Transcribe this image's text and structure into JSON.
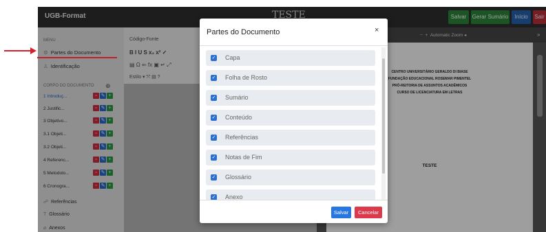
{
  "topbar": {
    "brand": "UGB-Format",
    "doc_title": "TESTE",
    "buttons": [
      "Salvar",
      "Gerar Sumário",
      "Início",
      "Sair"
    ]
  },
  "sidebar": {
    "menu_label": "MENU",
    "items": [
      {
        "icon": "settings-icon",
        "label": "Partes do Documento"
      },
      {
        "icon": "person-icon",
        "label": "Identificação"
      }
    ],
    "corpo_label": "CORPO DO DOCUMENTO",
    "sections": [
      "1 Introduç...",
      "2 Justific...",
      "3 Objetivo...",
      "3.1 Objeti...",
      "3.2 Objeti...",
      "4 Referenc...",
      "5 Metodolo...",
      "6 Cronogra..."
    ],
    "extra_items": [
      {
        "icon": "refs-icon",
        "label": "Referências"
      },
      {
        "icon": "glossary-icon",
        "label": "Glossário"
      },
      {
        "icon": "attachment-icon",
        "label": "Anexos"
      }
    ]
  },
  "editor": {
    "row1": "Código-Fonte",
    "row2": "B  I  U  S  x₂  x²  ✓",
    "row3": "▤  Ω  ⇐  fx  ▣  ↵  ⤢",
    "row4": "Estilo  ▾  ⤧  ▤  ?"
  },
  "viewer": {
    "zoom_label": "Automatic Zoom",
    "header_lines": [
      "CENTRO UNIVERSITÁRIO GERALDO DI BIASE",
      "FUNDAÇÃO EDUCACIONAL ROSEMAR PIMENTEL",
      "PRÓ-REITORIA DE ASSUNTOS ACADÊMICOS",
      "CURSO DE LICENCIATURA EM LETRAS"
    ],
    "page_title": "TESTE"
  },
  "modal": {
    "title": "Partes do Documento",
    "close": "×",
    "items": [
      {
        "label": "Capa",
        "checked": true
      },
      {
        "label": "Folha de Rosto",
        "checked": true
      },
      {
        "label": "Sumário",
        "checked": true
      },
      {
        "label": "Conteúdo",
        "checked": true
      },
      {
        "label": "Referências",
        "checked": true
      },
      {
        "label": "Notas de Fim",
        "checked": true
      },
      {
        "label": "Glossário",
        "checked": true
      },
      {
        "label": "Anexo",
        "checked": true
      }
    ],
    "save": "Salvar",
    "cancel": "Cancelar"
  },
  "colors": {
    "accent_blue": "#2b6fd0",
    "danger_red": "#db3a4a",
    "success_green": "#2e8a3a",
    "annotation_red": "#d8202a"
  }
}
